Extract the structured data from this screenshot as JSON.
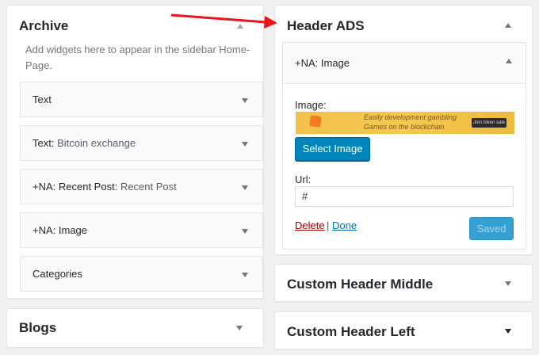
{
  "archive": {
    "title": "Archive",
    "description": "Add widgets here to appear in the sidebar Home-Page.",
    "widgets": [
      {
        "label": "Text",
        "sub": ""
      },
      {
        "label": "Text",
        "sub": "Bitcoin exchange"
      },
      {
        "label": "+NA: Recent Post",
        "sub": "Recent Post"
      },
      {
        "label": "+NA: Image",
        "sub": ""
      },
      {
        "label": "Categories",
        "sub": ""
      }
    ]
  },
  "blogs": {
    "title": "Blogs"
  },
  "header_ads": {
    "title": "Header ADS",
    "widget": {
      "title": "+NA: Image",
      "image_label": "Image:",
      "banner_line1": "Easily development gambling",
      "banner_line2": "Games on the blockchain",
      "banner_cta": "Join token sale",
      "select_image": "Select Image",
      "url_label": "Url:",
      "url_value": "#",
      "delete": "Delete",
      "separator": "|",
      "done": "Done",
      "saved": "Saved"
    }
  },
  "custom_header_middle": {
    "title": "Custom Header Middle"
  },
  "custom_header_left": {
    "title": "Custom Header Left"
  },
  "colors": {
    "annotation_arrow": "#e8151b",
    "button_primary": "#0085ba",
    "delete_link": "#a00",
    "done_link": "#0073aa"
  }
}
